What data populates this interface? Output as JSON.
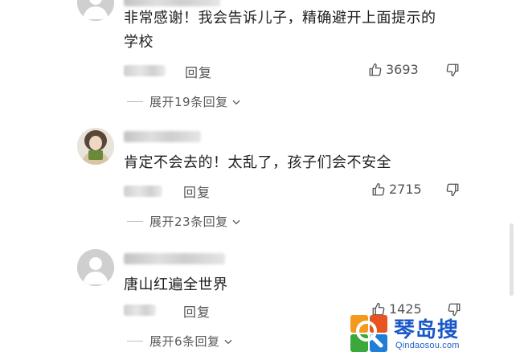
{
  "comments": [
    {
      "text_line1": "非常感谢！我会告诉儿子，精确避开上面提示的",
      "text_line2": "学校",
      "reply_label": "回复",
      "likes": "3693",
      "expand_label": "展开19条回复"
    },
    {
      "text_line1": "肯定不会去的！太乱了，孩子们会不安全",
      "reply_label": "回复",
      "likes": "2715",
      "expand_label": "展开23条回复"
    },
    {
      "text_line1": "唐山红遍全世界",
      "reply_label": "回复",
      "likes": "1425",
      "expand_label": "展开6条回复"
    }
  ],
  "watermark": {
    "title": "琴岛搜",
    "url": "Qindaosou.com"
  },
  "colors": {
    "text": "#1e1e1e",
    "meta": "#555555",
    "watermark": "#1a57c8"
  },
  "icons": [
    "thumbs-up-icon",
    "thumbs-down-icon",
    "chevron-down-icon",
    "default-avatar-icon"
  ]
}
